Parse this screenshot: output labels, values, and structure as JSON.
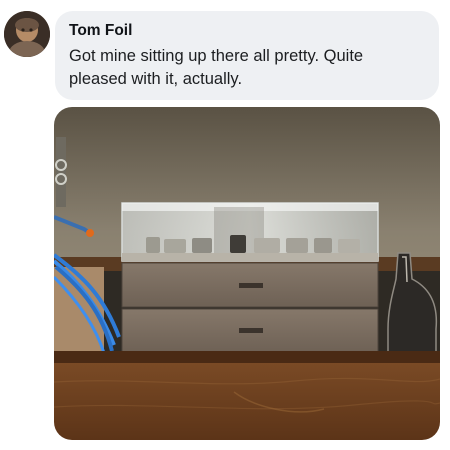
{
  "post": {
    "author": "Tom Foil",
    "message": "Got mine sitting up there all pretty. Quite pleased with it, actually."
  },
  "avatar": {
    "icon": "user-avatar"
  },
  "attachment": {
    "type": "photo"
  }
}
